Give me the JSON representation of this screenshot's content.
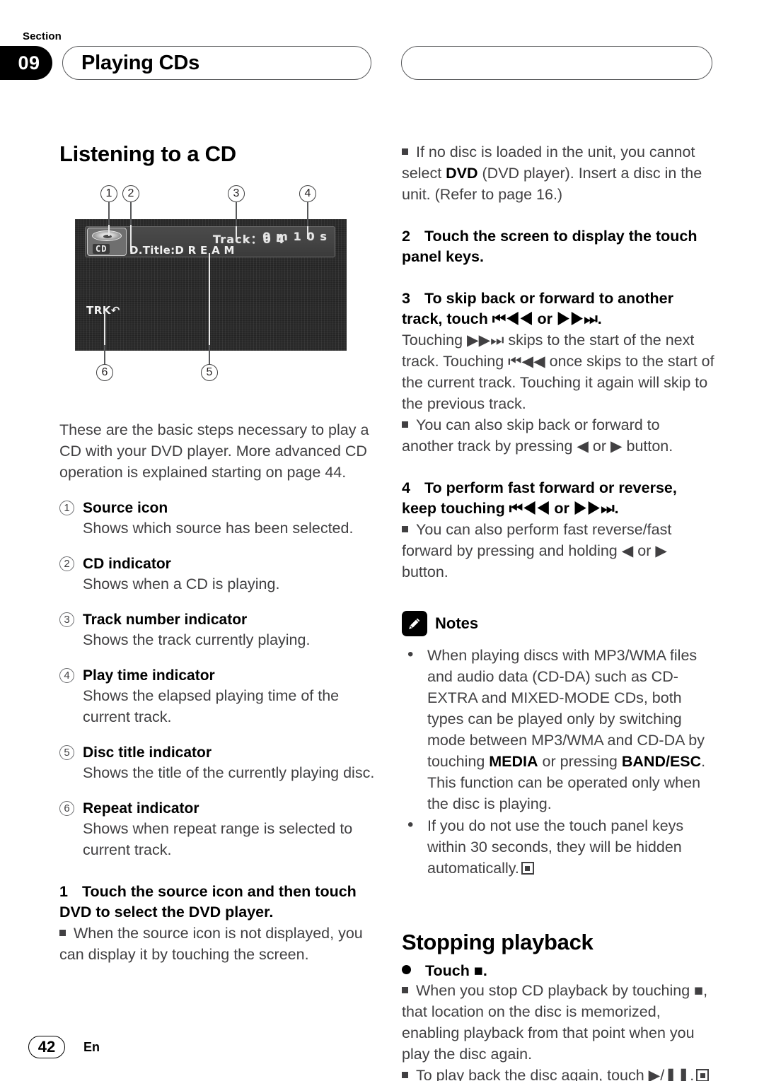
{
  "header": {
    "section_label": "Section",
    "section_number": "09",
    "title": "Playing CDs"
  },
  "left_column": {
    "heading": "Listening to a CD",
    "intro": "These are the basic steps necessary to play a CD with your DVD player. More advanced CD operation is explained starting on page 44.",
    "definitions": [
      {
        "num": "1",
        "term": "Source icon",
        "desc": "Shows which source has been selected."
      },
      {
        "num": "2",
        "term": "CD indicator",
        "desc": "Shows when a CD is playing."
      },
      {
        "num": "3",
        "term": "Track number indicator",
        "desc": "Shows the track currently playing."
      },
      {
        "num": "4",
        "term": "Play time indicator",
        "desc": "Shows the elapsed playing time of the current track."
      },
      {
        "num": "5",
        "term": "Disc title indicator",
        "desc": "Shows the title of the currently playing disc."
      },
      {
        "num": "6",
        "term": "Repeat indicator",
        "desc": "Shows when repeat range is selected to current track."
      }
    ],
    "step1": {
      "number": "1",
      "text": "Touch the source icon and then touch DVD to select the DVD player.",
      "note": "When the source icon is not displayed, you can display it by touching the screen."
    }
  },
  "figure": {
    "callouts": [
      "1",
      "2",
      "3",
      "4",
      "5",
      "6"
    ],
    "lcd": {
      "source_icon_label": "CD",
      "track_label": "Track：0 4",
      "time_label": "0 m 1 0 s",
      "disc_title": "D.Title:D R E A M",
      "repeat_label": "TRK"
    }
  },
  "right_column": {
    "note_top": {
      "text_pre": "If no disc is loaded in the unit, you cannot select ",
      "bold": "DVD",
      "text_post": " (DVD player). Insert a disc in the unit. (Refer to page 16.)"
    },
    "step2": {
      "number": "2",
      "text": "Touch the screen to display the touch panel keys."
    },
    "step3": {
      "number": "3",
      "text": "To skip back or forward to another track, touch ⏮◀◀ or ▶▶⏭.",
      "body": "Touching ▶▶⏭ skips to the start of the next track. Touching ⏮◀◀ once skips to the start of the current track. Touching it again will skip to the previous track.",
      "note": "You can also skip back or forward to another track by pressing ◀ or ▶ button."
    },
    "step4": {
      "number": "4",
      "text": "To perform fast forward or reverse, keep touching ⏮◀◀ or ▶▶⏭.",
      "note": "You can also perform fast reverse/fast forward by pressing and holding ◀ or ▶ button."
    },
    "notes": {
      "title": "Notes",
      "items": [
        {
          "part1": "When playing discs with MP3/WMA files and audio data (CD-DA) such as CD-EXTRA and MIXED-MODE CDs, both types can be played only by switching mode between MP3/WMA and CD-DA by touching ",
          "bold1": "MEDIA",
          "part2": " or pressing ",
          "bold2": "BAND/ESC",
          "part3": ". This function can be operated only when the disc is playing."
        },
        {
          "part1": "If you do not use the touch panel keys within 30 seconds, they will be hidden automatically.",
          "end_marker": true
        }
      ]
    },
    "stopping": {
      "heading": "Stopping playback",
      "bullet": "Touch ■.",
      "note1": "When you stop CD playback by touching ■, that location on the disc is memorized, enabling playback from that point when you play the disc again.",
      "note2": "To play back the disc again, touch ▶/❚❚."
    }
  },
  "footer": {
    "page_number": "42",
    "language": "En"
  }
}
